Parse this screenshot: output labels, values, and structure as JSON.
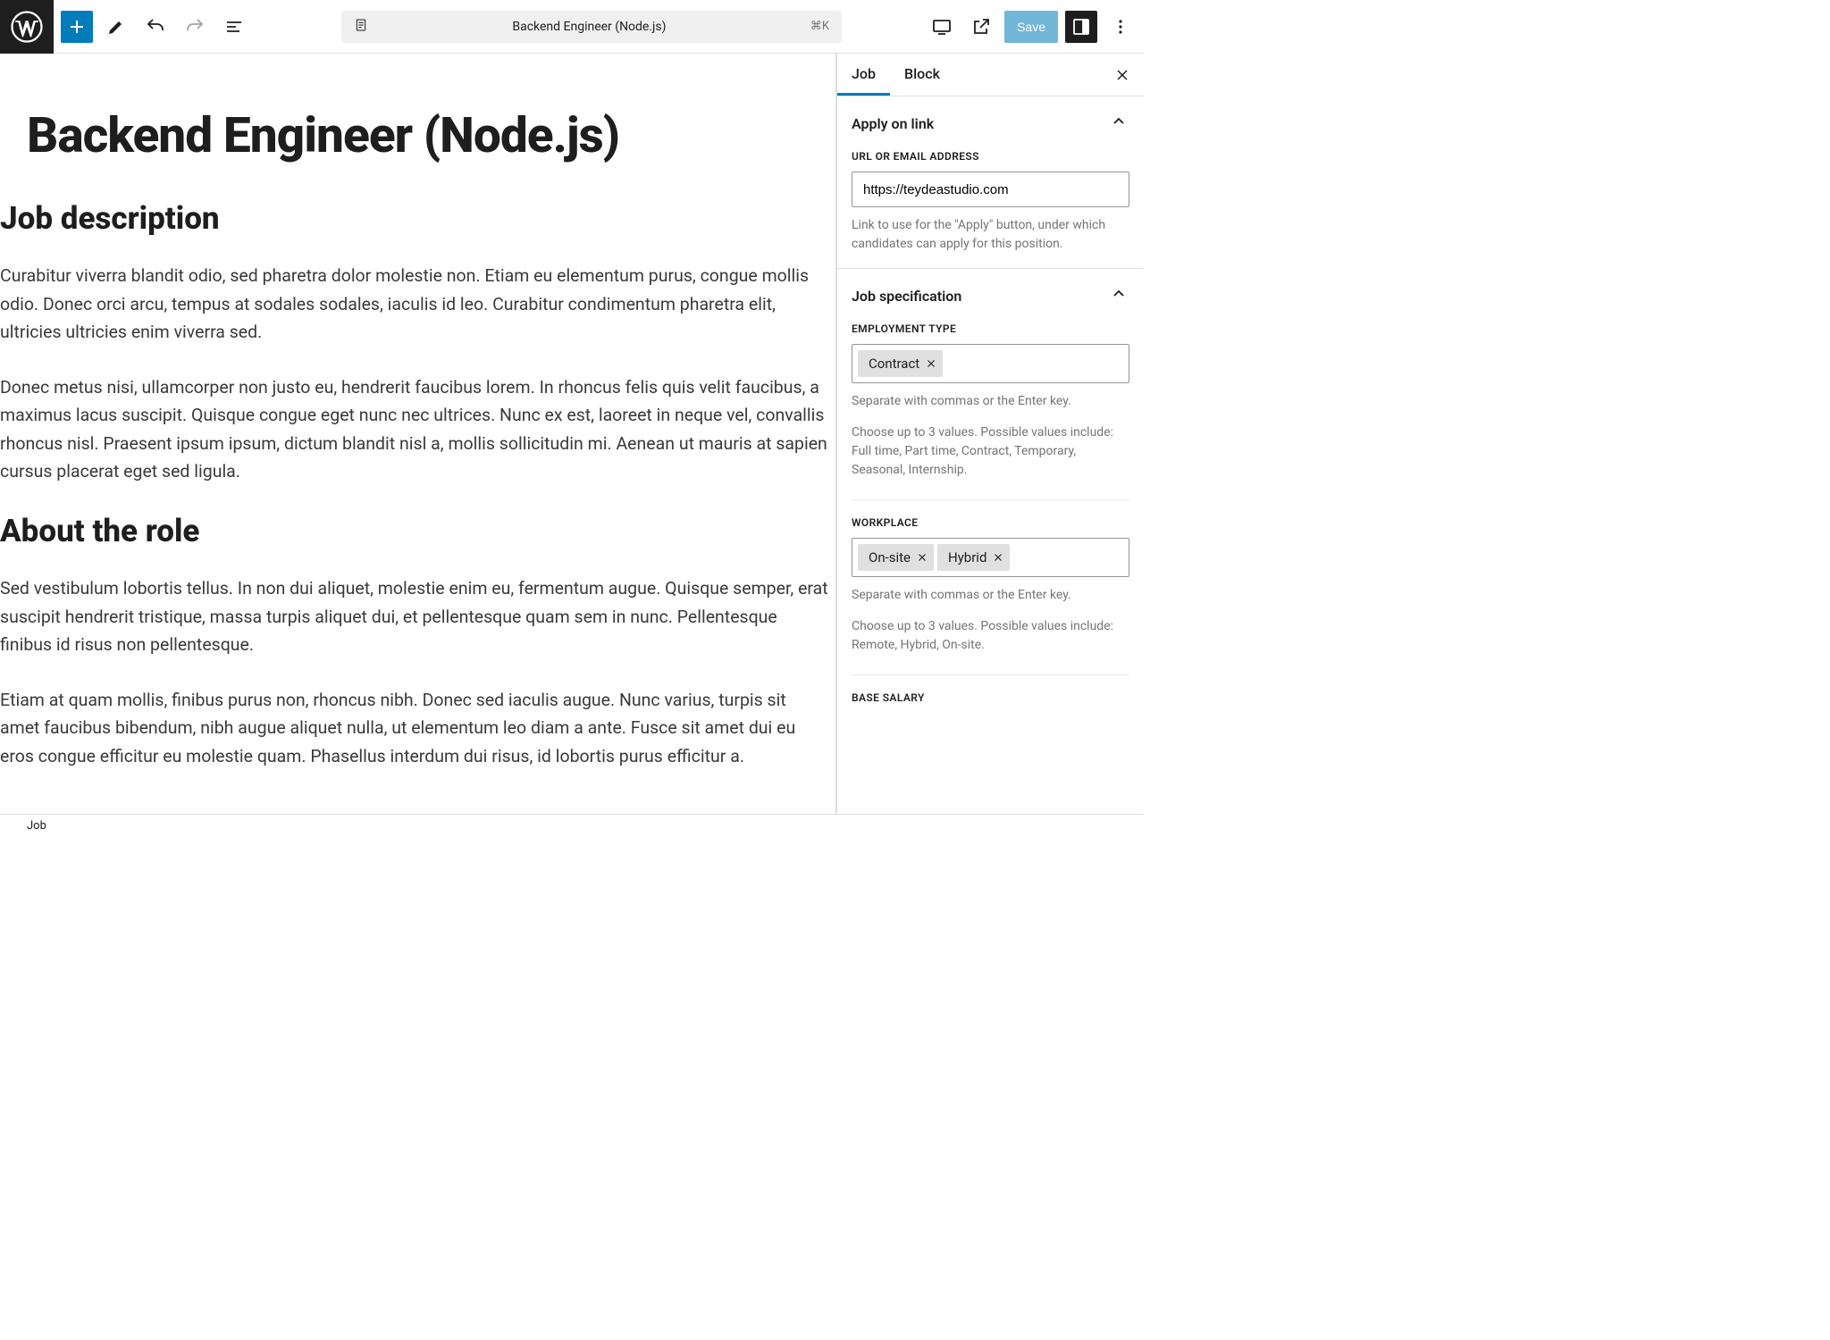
{
  "header": {
    "doc_title": "Backend Engineer (Node.js)",
    "shortcut": "⌘K",
    "save_label": "Save"
  },
  "editor": {
    "title": "Backend Engineer (Node.js)",
    "h2_1": "Job description",
    "p1": "Curabitur viverra blandit odio, sed pharetra dolor molestie non. Etiam eu elementum purus, congue mollis odio. Donec orci arcu, tempus at sodales sodales, iaculis id leo. Curabitur condimentum pharetra elit, ultricies ultricies enim viverra sed.",
    "p2": "Donec metus nisi, ullamcorper non justo eu, hendrerit faucibus lorem. In rhoncus felis quis velit faucibus, a maximus lacus suscipit. Quisque congue eget nunc nec ultrices. Nunc ex est, laoreet in neque vel, convallis rhoncus nisl. Praesent ipsum ipsum, dictum blandit nisl a, mollis sollicitudin mi. Aenean ut mauris at sapien cursus placerat eget sed ligula.",
    "h2_2": "About the role",
    "p3": "Sed vestibulum lobortis tellus. In non dui aliquet, molestie enim eu, fermentum augue. Quisque semper, erat suscipit hendrerit tristique, massa turpis aliquet dui, et pellentesque quam sem in nunc. Pellentesque finibus id risus non pellentesque.",
    "p4": "Etiam at quam mollis, finibus purus non, rhoncus nibh. Donec sed iaculis augue. Nunc varius, turpis sit amet faucibus bibendum, nibh augue aliquet nulla, ut elementum leo diam a ante. Fusce sit amet dui eu eros congue efficitur eu molestie quam. Phasellus interdum dui risus, id lobortis purus efficitur a."
  },
  "sidebar": {
    "tabs": {
      "job": "Job",
      "block": "Block"
    },
    "apply": {
      "title": "Apply on link",
      "url_label": "URL OR EMAIL ADDRESS",
      "url_value": "https://teydeastudio.com",
      "url_help": "Link to use for the \"Apply\" button, under which candidates can apply for this position."
    },
    "spec": {
      "title": "Job specification",
      "employment_label": "EMPLOYMENT TYPE",
      "employment_tokens": [
        "Contract"
      ],
      "tokens_help1": "Separate with commas or the Enter key.",
      "employment_help2": "Choose up to 3 values. Possible values include: Full time, Part time, Contract, Temporary, Seasonal, Internship.",
      "workplace_label": "WORKPLACE",
      "workplace_tokens": [
        "On-site",
        "Hybrid"
      ],
      "workplace_help2": "Choose up to 3 values. Possible values include: Remote, Hybrid, On-site.",
      "salary_label": "BASE SALARY"
    }
  },
  "footer": {
    "breadcrumb": "Job"
  }
}
